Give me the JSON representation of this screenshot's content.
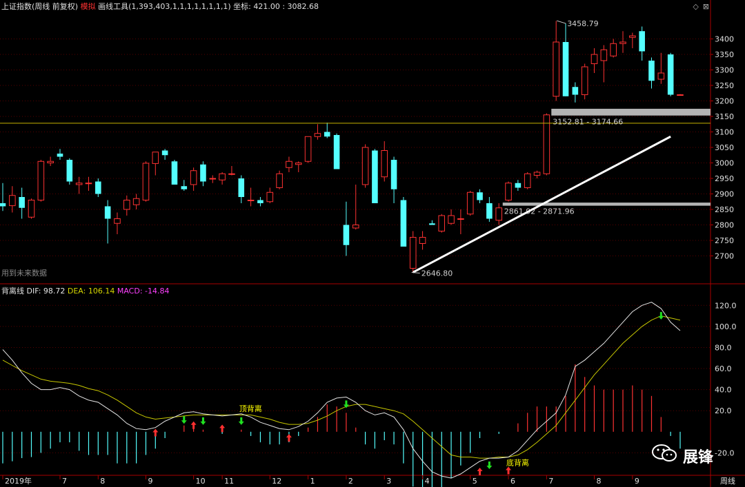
{
  "header": {
    "index_name": "上证指数",
    "period": "(周线 前复权)",
    "mode_label": "模拟",
    "tool_label": "画线工具(1,393,403,1,1,1,1,1,1,1,1)",
    "coord_label": "坐标: 421.00 : 3082.68",
    "future_data_label": "用到未来数据"
  },
  "macd_header": {
    "title": "背离线",
    "dif_label": "DIF: 98.72",
    "dea_label": "DEA: 106.14",
    "macd_label": "MACD: -14.84"
  },
  "watermark": {
    "text": "展锋"
  },
  "colors": {
    "up": "#ff3232",
    "down": "#54ffff",
    "grid": "#5a0000",
    "axis": "#aa0000",
    "dea": "#c8c800",
    "dif": "#e6e6e6",
    "macd_pos": "#ff3232",
    "macd_neg": "#54ffff",
    "level": "#c8b400"
  },
  "chart_data": {
    "type": "candlestick",
    "title": "上证指数 周线",
    "x_ticks": [
      "2019年",
      "7",
      "8",
      "9",
      "10",
      "11",
      "12",
      "1",
      "2",
      "3",
      "4",
      "5",
      "6",
      "7",
      "8",
      "9"
    ],
    "x_tick_positions": [
      0,
      6,
      10,
      15,
      20,
      23,
      28,
      32,
      36,
      40,
      44,
      49,
      53,
      57,
      62,
      66
    ],
    "bottom_right_label": "周线",
    "price_axis": {
      "ticks": [
        2700,
        2750,
        2800,
        2850,
        2900,
        2950,
        3000,
        3050,
        3100,
        3150,
        3200,
        3250,
        3300,
        3350,
        3400
      ],
      "range": [
        2610,
        3490
      ]
    },
    "candles": [
      {
        "o": 2870,
        "h": 2935,
        "l": 2845,
        "c": 2860
      },
      {
        "o": 2862,
        "h": 2925,
        "l": 2840,
        "c": 2895
      },
      {
        "o": 2890,
        "h": 2920,
        "l": 2820,
        "c": 2855
      },
      {
        "o": 2825,
        "h": 2885,
        "l": 2820,
        "c": 2880
      },
      {
        "o": 2880,
        "h": 3010,
        "l": 2875,
        "c": 3005
      },
      {
        "o": 3000,
        "h": 3020,
        "l": 2990,
        "c": 3005
      },
      {
        "o": 3030,
        "h": 3045,
        "l": 3010,
        "c": 3020
      },
      {
        "o": 3010,
        "h": 3015,
        "l": 2930,
        "c": 2940
      },
      {
        "o": 2930,
        "h": 2955,
        "l": 2900,
        "c": 2935
      },
      {
        "o": 2935,
        "h": 2955,
        "l": 2910,
        "c": 2935
      },
      {
        "o": 2940,
        "h": 2950,
        "l": 2890,
        "c": 2900
      },
      {
        "o": 2860,
        "h": 2880,
        "l": 2740,
        "c": 2820
      },
      {
        "o": 2805,
        "h": 2840,
        "l": 2770,
        "c": 2820
      },
      {
        "o": 2850,
        "h": 2895,
        "l": 2830,
        "c": 2880
      },
      {
        "o": 2865,
        "h": 2900,
        "l": 2850,
        "c": 2885
      },
      {
        "o": 2880,
        "h": 3005,
        "l": 2875,
        "c": 2999
      },
      {
        "o": 2998,
        "h": 3025,
        "l": 2960,
        "c": 3035
      },
      {
        "o": 3040,
        "h": 3045,
        "l": 3010,
        "c": 3025
      },
      {
        "o": 3005,
        "h": 3010,
        "l": 2940,
        "c": 2930
      },
      {
        "o": 2925,
        "h": 2945,
        "l": 2910,
        "c": 2915
      },
      {
        "o": 2930,
        "h": 2985,
        "l": 2910,
        "c": 2975
      },
      {
        "o": 2995,
        "h": 3005,
        "l": 2925,
        "c": 2940
      },
      {
        "o": 2948,
        "h": 2960,
        "l": 2935,
        "c": 2950
      },
      {
        "o": 2945,
        "h": 2970,
        "l": 2930,
        "c": 2965
      },
      {
        "o": 2965,
        "h": 2990,
        "l": 2960,
        "c": 2965
      },
      {
        "o": 2950,
        "h": 2960,
        "l": 2870,
        "c": 2890
      },
      {
        "o": 2880,
        "h": 2920,
        "l": 2860,
        "c": 2880
      },
      {
        "o": 2880,
        "h": 2890,
        "l": 2860,
        "c": 2870
      },
      {
        "o": 2875,
        "h": 2920,
        "l": 2870,
        "c": 2905
      },
      {
        "o": 2920,
        "h": 2975,
        "l": 2915,
        "c": 2965
      },
      {
        "o": 2985,
        "h": 3020,
        "l": 2970,
        "c": 3005
      },
      {
        "o": 2995,
        "h": 3005,
        "l": 2970,
        "c": 3000
      },
      {
        "o": 3005,
        "h": 3085,
        "l": 3000,
        "c": 3085
      },
      {
        "o": 3085,
        "h": 3125,
        "l": 3075,
        "c": 3095
      },
      {
        "o": 3100,
        "h": 3130,
        "l": 3080,
        "c": 3085
      },
      {
        "o": 3090,
        "h": 3095,
        "l": 3000,
        "c": 2980
      },
      {
        "o": 2800,
        "h": 2875,
        "l": 2700,
        "c": 2735
      },
      {
        "o": 2790,
        "h": 2930,
        "l": 2785,
        "c": 2800
      },
      {
        "o": 2930,
        "h": 3060,
        "l": 2920,
        "c": 3050
      },
      {
        "o": 3040,
        "h": 3045,
        "l": 2870,
        "c": 2870
      },
      {
        "o": 2955,
        "h": 3070,
        "l": 2940,
        "c": 3040
      },
      {
        "o": 3010,
        "h": 3020,
        "l": 2870,
        "c": 2915
      },
      {
        "o": 2880,
        "h": 2890,
        "l": 2740,
        "c": 2730
      },
      {
        "o": 2660,
        "h": 2780,
        "l": 2647,
        "c": 2760
      },
      {
        "o": 2740,
        "h": 2780,
        "l": 2720,
        "c": 2760
      },
      {
        "o": 2805,
        "h": 2815,
        "l": 2800,
        "c": 2800
      },
      {
        "o": 2780,
        "h": 2835,
        "l": 2775,
        "c": 2830
      },
      {
        "o": 2805,
        "h": 2850,
        "l": 2800,
        "c": 2830
      },
      {
        "o": 2820,
        "h": 2850,
        "l": 2770,
        "c": 2820
      },
      {
        "o": 2835,
        "h": 2910,
        "l": 2830,
        "c": 2905
      },
      {
        "o": 2905,
        "h": 2915,
        "l": 2870,
        "c": 2880
      },
      {
        "o": 2870,
        "h": 2890,
        "l": 2810,
        "c": 2820
      },
      {
        "o": 2815,
        "h": 2870,
        "l": 2800,
        "c": 2855
      },
      {
        "o": 2880,
        "h": 2940,
        "l": 2875,
        "c": 2935
      },
      {
        "o": 2935,
        "h": 2945,
        "l": 2910,
        "c": 2920
      },
      {
        "o": 2920,
        "h": 2970,
        "l": 2915,
        "c": 2965
      },
      {
        "o": 2960,
        "h": 2975,
        "l": 2950,
        "c": 2970
      },
      {
        "o": 2965,
        "h": 3160,
        "l": 2960,
        "c": 3155
      },
      {
        "o": 3215,
        "h": 3458,
        "l": 3200,
        "c": 3390
      },
      {
        "o": 3390,
        "h": 3450,
        "l": 3215,
        "c": 3215
      },
      {
        "o": 3245,
        "h": 3260,
        "l": 3195,
        "c": 3220
      },
      {
        "o": 3220,
        "h": 3320,
        "l": 3205,
        "c": 3310
      },
      {
        "o": 3320,
        "h": 3370,
        "l": 3290,
        "c": 3350
      },
      {
        "o": 3330,
        "h": 3380,
        "l": 3260,
        "c": 3365
      },
      {
        "o": 3345,
        "h": 3400,
        "l": 3340,
        "c": 3385
      },
      {
        "o": 3385,
        "h": 3425,
        "l": 3355,
        "c": 3390
      },
      {
        "o": 3405,
        "h": 3420,
        "l": 3370,
        "c": 3410
      },
      {
        "o": 3425,
        "h": 3440,
        "l": 3330,
        "c": 3360
      },
      {
        "o": 3330,
        "h": 3340,
        "l": 3240,
        "c": 3265
      },
      {
        "o": 3270,
        "h": 3355,
        "l": 3255,
        "c": 3290
      },
      {
        "o": 3350,
        "h": 3355,
        "l": 3215,
        "c": 3220
      },
      {
        "o": 3220,
        "h": 3222,
        "l": 3218,
        "c": 3220
      }
    ],
    "annotations": {
      "high_label": "3458.79",
      "low_label": "2646.80",
      "zone_upper_label": "3152.81 - 3174.66",
      "zone_lower_label": "2861.92 - 2871.96",
      "zone_upper": [
        3152.81,
        3174.66
      ],
      "zone_lower": [
        2861.92,
        2871.96
      ],
      "level_line": 3128,
      "trendline": {
        "from": [
          43,
          2647
        ],
        "to": [
          70,
          3085
        ]
      }
    },
    "macd_axis": {
      "ticks": [
        -20,
        20,
        40,
        60,
        80,
        100,
        120
      ],
      "range": [
        -40,
        130
      ]
    },
    "dif": [
      78,
      68,
      56,
      46,
      40,
      40,
      42,
      40,
      34,
      30,
      28,
      22,
      16,
      8,
      3,
      2,
      4,
      10,
      14,
      18,
      19,
      17,
      16,
      15,
      16,
      17,
      14,
      9,
      6,
      3,
      2,
      5,
      10,
      18,
      28,
      32,
      33,
      28,
      20,
      16,
      18,
      14,
      2,
      -16,
      -28,
      -38,
      -42,
      -44,
      -40,
      -34,
      -28,
      -25,
      -25,
      -24,
      -18,
      -8,
      2,
      10,
      18,
      35,
      62,
      68,
      76,
      84,
      94,
      104,
      114,
      120,
      123,
      117,
      104,
      96
    ],
    "dea": [
      68,
      63,
      58,
      54,
      50,
      48,
      47,
      46,
      44,
      41,
      39,
      35,
      30,
      24,
      18,
      14,
      12,
      13,
      14,
      15,
      16,
      16,
      16,
      16,
      16,
      16,
      16,
      14,
      12,
      9,
      7,
      7,
      8,
      11,
      15,
      20,
      24,
      26,
      26,
      24,
      22,
      20,
      17,
      10,
      2,
      -6,
      -14,
      -22,
      -24,
      -24,
      -25,
      -25,
      -24,
      -24,
      -22,
      -17,
      -10,
      -2,
      6,
      18,
      30,
      42,
      54,
      64,
      74,
      84,
      92,
      100,
      106,
      110,
      108,
      106
    ],
    "macd": [
      -30,
      -28,
      -25,
      -24,
      -20,
      -16,
      -10,
      -10,
      -18,
      -22,
      -22,
      -22,
      -30,
      -30,
      -30,
      -22,
      -16,
      -6,
      0,
      6,
      6,
      2,
      0,
      -2,
      0,
      2,
      -4,
      -10,
      -12,
      -12,
      -10,
      -4,
      4,
      14,
      26,
      24,
      18,
      4,
      -12,
      -16,
      -8,
      -12,
      -30,
      -52,
      -60,
      -64,
      -56,
      -44,
      -32,
      -20,
      -6,
      0,
      -2,
      0,
      8,
      18,
      24,
      24,
      24,
      34,
      64,
      52,
      44,
      40,
      40,
      40,
      44,
      40,
      34,
      14,
      -4,
      -16
    ],
    "markers": [
      {
        "i": 16,
        "dir": "up"
      },
      {
        "i": 19,
        "dir": "down"
      },
      {
        "i": 20,
        "dir": "up"
      },
      {
        "i": 21,
        "dir": "down"
      },
      {
        "i": 23,
        "dir": "up"
      },
      {
        "i": 25,
        "dir": "down"
      },
      {
        "i": 30,
        "dir": "up"
      },
      {
        "i": 36,
        "dir": "down"
      },
      {
        "i": 50,
        "dir": "up"
      },
      {
        "i": 51,
        "dir": "down"
      },
      {
        "i": 53,
        "dir": "up"
      },
      {
        "i": 69,
        "dir": "down"
      }
    ],
    "divergence_labels": [
      {
        "i": 25,
        "text": "顶背离"
      },
      {
        "i": 53,
        "text": "底背离"
      }
    ]
  }
}
